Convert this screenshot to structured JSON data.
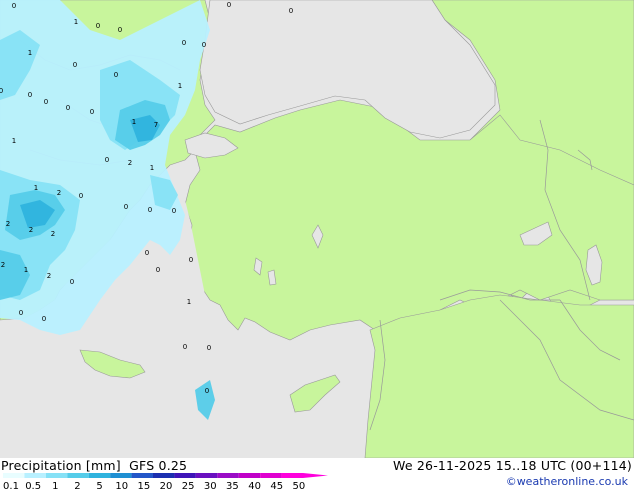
{
  "title": {
    "product": "Precipitation [mm]",
    "model": "GFS 0.25",
    "valid_time": "We 26-11-2025 15..18 UTC (00+114)"
  },
  "copyright": "©weatheronline.co.uk",
  "legend": {
    "ticks": [
      "0.1",
      "0.5",
      "1",
      "2",
      "5",
      "10",
      "15",
      "20",
      "25",
      "30",
      "35",
      "40",
      "45",
      "50"
    ],
    "colors": [
      "#e8fdff",
      "#b8f0ff",
      "#86e1f6",
      "#55cce9",
      "#2fb3de",
      "#1f8fd2",
      "#2356c8",
      "#1c2fb0",
      "#3f14b8",
      "#6a10c0",
      "#9a0cc6",
      "#c000c8",
      "#e000d0",
      "#ff00dd"
    ]
  },
  "colors": {
    "sea": "#e6e6e6",
    "land": "#c8f59c",
    "border": "#999999"
  },
  "map_labels": [
    {
      "text": "0"
    },
    {
      "text": "1"
    },
    {
      "text": "0"
    },
    {
      "text": "0"
    },
    {
      "text": "0"
    },
    {
      "text": "0"
    },
    {
      "text": "0"
    },
    {
      "text": "0"
    },
    {
      "text": "1"
    },
    {
      "text": "0"
    },
    {
      "text": "0"
    },
    {
      "text": "0"
    },
    {
      "text": "0"
    },
    {
      "text": "1"
    },
    {
      "text": "0"
    },
    {
      "text": "1"
    },
    {
      "text": "0"
    },
    {
      "text": "0"
    },
    {
      "text": "1"
    },
    {
      "text": "7"
    },
    {
      "text": "0"
    },
    {
      "text": "2"
    },
    {
      "text": "1"
    },
    {
      "text": "1"
    },
    {
      "text": "2"
    },
    {
      "text": "0"
    },
    {
      "text": "0"
    },
    {
      "text": "2"
    },
    {
      "text": "2"
    },
    {
      "text": "2"
    },
    {
      "text": "0"
    },
    {
      "text": "0"
    },
    {
      "text": "2"
    },
    {
      "text": "0"
    },
    {
      "text": "1"
    },
    {
      "text": "2"
    },
    {
      "text": "0"
    },
    {
      "text": "0"
    },
    {
      "text": "0"
    },
    {
      "text": "1"
    },
    {
      "text": "0"
    },
    {
      "text": "0"
    },
    {
      "text": "0"
    },
    {
      "text": "0"
    },
    {
      "text": "0"
    }
  ]
}
